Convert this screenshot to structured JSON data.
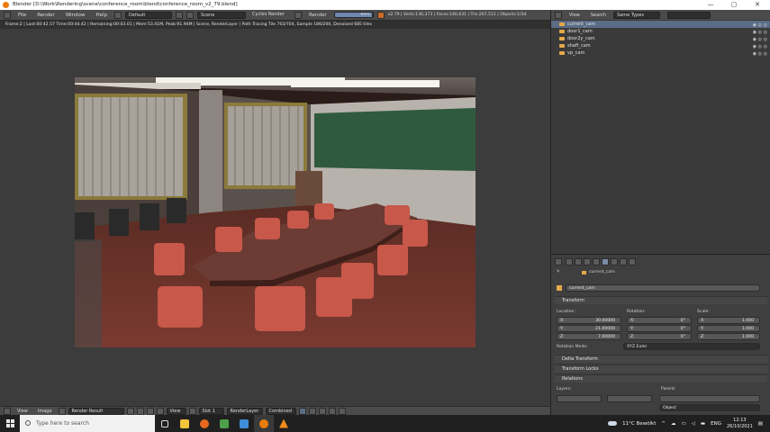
{
  "window": {
    "title": "Blender [D:\\Work\\Rendering\\scene\\conference_room\\blend\\conference_room_v2_79.blend]",
    "controls": [
      "—",
      "▢",
      "✕"
    ]
  },
  "menubar": {
    "menus": [
      "File",
      "Render",
      "Window",
      "Help"
    ],
    "screen_layout": "Default",
    "scene": "Scene",
    "engine": "Cycles Render",
    "render_label": "Render",
    "progress_label": "99%",
    "progress": 0.99,
    "stats": "v2.79 | Verts:136,373 | Faces:140,631 | Tris:267,512 | Objects:1/34"
  },
  "statusline": "Frame:2 | Last:00:42.57 Time:00:44.42 | Remaining:00:03.01 | Mem:53.41M, Peak:91.94M | Scene, RenderLayer | Path Tracing Tile 703/704, Sample 186/200, Denoised 685 tiles",
  "image_editor": {
    "menus": [
      "View",
      "Image"
    ],
    "image": "Render Result",
    "view_label": "View",
    "slot": "Slot 1",
    "layer": "RenderLayer",
    "pass": "Combined"
  },
  "outliner": {
    "menus": [
      "View",
      "Search"
    ],
    "filter": "Same Types",
    "items": [
      {
        "label": "current_cam",
        "selected": true
      },
      {
        "label": "door1_cam",
        "selected": false
      },
      {
        "label": "door2y_cam",
        "selected": false
      },
      {
        "label": "shaft_cam",
        "selected": false
      },
      {
        "label": "vp_cam",
        "selected": false
      }
    ]
  },
  "properties": {
    "breadcrumb": "current_cam",
    "object_name": "current_cam",
    "transform_header": "Transform",
    "location_label": "Location:",
    "rotation_label": "Rotation:",
    "scale_label": "Scale:",
    "location": [
      {
        "axis": "X:",
        "value": "30.00000"
      },
      {
        "axis": "Y:",
        "value": "21.00000"
      },
      {
        "axis": "Z:",
        "value": "7.00000"
      }
    ],
    "rotation": [
      {
        "axis": "X:",
        "value": "0°"
      },
      {
        "axis": "Y:",
        "value": "0°"
      },
      {
        "axis": "Z:",
        "value": "0°"
      }
    ],
    "scale": [
      {
        "axis": "X:",
        "value": "1.000"
      },
      {
        "axis": "Y:",
        "value": "1.000"
      },
      {
        "axis": "Z:",
        "value": "1.000"
      }
    ],
    "rotation_mode_label": "Rotation Mode:",
    "rotation_mode": "XYZ Euler",
    "delta_transform": "Delta Transform",
    "transform_locks": "Transform Locks",
    "relations": "Relations",
    "layers_label": "Layers:",
    "parent_label": "Parent:",
    "parent_type": "Object"
  },
  "taskbar": {
    "search_placeholder": "Type here to search",
    "weather": "11°C  Bewölkt",
    "lang": "ENG",
    "time": "12:13",
    "date": "26/10/2021"
  }
}
